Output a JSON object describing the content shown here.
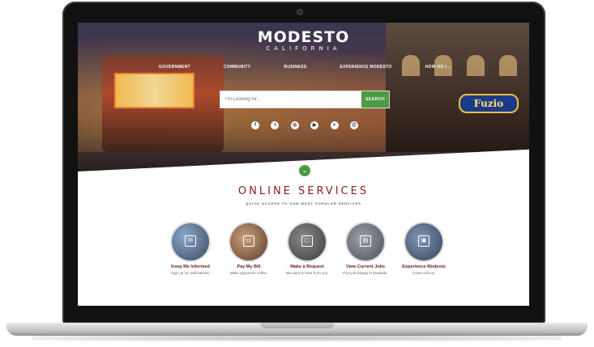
{
  "site": {
    "logo_title": "MODESTO",
    "logo_subtitle": "CALIFORNIA"
  },
  "nav": {
    "items": [
      "GOVERNMENT",
      "COMMUNITY",
      "BUSINESS",
      "EXPERIENCE MODESTO",
      "HOW DO I..."
    ]
  },
  "search": {
    "placeholder": "I'm Looking for...",
    "button_label": "SEARCH"
  },
  "hero_sign": "Fuzio",
  "social": [
    {
      "icon": "facebook-icon",
      "glyph": "f"
    },
    {
      "icon": "twitter-icon",
      "glyph": "t"
    },
    {
      "icon": "instagram-icon",
      "glyph": "◎"
    },
    {
      "icon": "youtube-icon",
      "glyph": "▶"
    },
    {
      "icon": "share-icon",
      "glyph": "<"
    },
    {
      "icon": "email-icon",
      "glyph": "@"
    }
  ],
  "scroll_icon": "chevron-down-icon",
  "services": {
    "title": "ONLINE SERVICES",
    "subtitle": "QUICK ACCESS TO OUR MOST POPULAR SERVICES",
    "items": [
      {
        "label": "Keep Me Informed",
        "desc": "Sign up for notifications.",
        "icon": "envelope-icon",
        "glyph": "✉"
      },
      {
        "label": "Pay My Bill",
        "desc": "Make payments online.",
        "icon": "credit-card-icon",
        "glyph": "▭"
      },
      {
        "label": "Make a Request",
        "desc": "We want to hear from you.",
        "icon": "monitor-icon",
        "glyph": "▢"
      },
      {
        "label": "View Current Jobs",
        "desc": "Find job listings in Modesto.",
        "icon": "briefcase-icon",
        "glyph": "▤"
      },
      {
        "label": "Experience Modesto",
        "desc": "Come visit us.",
        "icon": "image-icon",
        "glyph": "▣"
      }
    ]
  }
}
